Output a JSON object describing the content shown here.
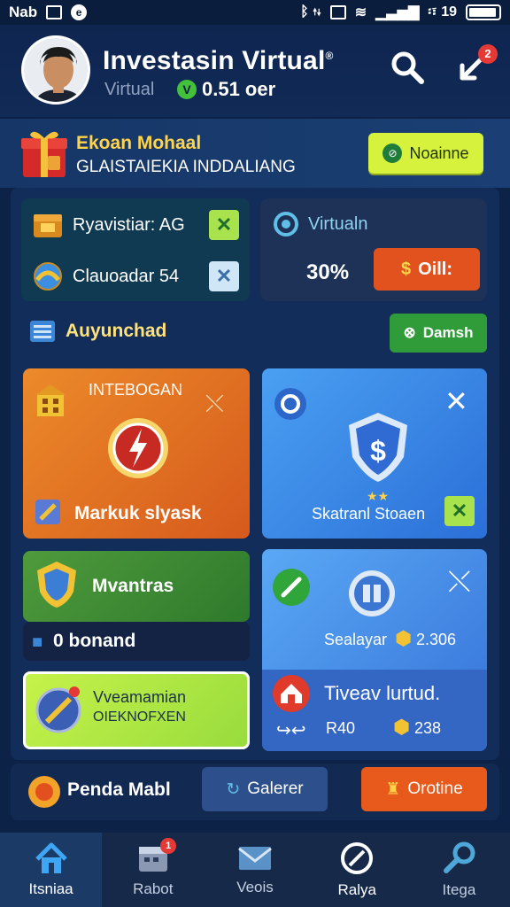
{
  "status_bar": {
    "carrier": "Nab",
    "right_text": "ᛒ ⇅",
    "time_text": "፡፣ 19"
  },
  "header": {
    "title": "Investasin Virtual",
    "subtitle_label": "Virtual",
    "subtitle_value": "0.51 oer",
    "notification_count": "2",
    "icons": [
      "search-icon",
      "share-icon"
    ]
  },
  "banner": {
    "title": "Ekoan Mohaal",
    "subtitle": "GLAISTAIEKIA INDDALIANG",
    "button_label": "Noainne"
  },
  "stats": {
    "row1_label": "Ryavistiar: AG",
    "row2_label": "Clauoadar 54"
  },
  "virtual_card": {
    "title": "Virtualn",
    "percent": "30%",
    "button_label": "Oill:"
  },
  "section": {
    "title": "Auyunchad",
    "button_label": "Damsh"
  },
  "tiles": {
    "orange": {
      "caption": "INTEBOGAN",
      "label": "Markuk slyask"
    },
    "blue": {
      "label": "Skatranl Stoaen"
    },
    "green": {
      "label": "Mvantras"
    },
    "dark": {
      "label": "0 bonand"
    },
    "lime": {
      "title": "Vveamamian",
      "subtitle": "OIEKNOFXEN"
    },
    "blue2": {
      "label": "Sealayar",
      "value": "2.306",
      "title2": "Tiveav lurtud.",
      "sub_left": "R40",
      "sub_value": "238"
    }
  },
  "actions": {
    "left_label": "Penda Mabl",
    "blue_button": "Galerer",
    "orange_button": "Orotine"
  },
  "nav": {
    "items": [
      {
        "label": "Itsniaa",
        "icon": "home-icon"
      },
      {
        "label": "Rabot",
        "icon": "calendar-icon",
        "badge": "1"
      },
      {
        "label": "Veois",
        "icon": "mail-icon"
      },
      {
        "label": "Ralya",
        "icon": "compass-icon"
      },
      {
        "label": "Itega",
        "icon": "wrench-icon"
      }
    ]
  },
  "colors": {
    "background": "#0d2247",
    "accent_orange": "#e2521e",
    "accent_green": "#2f9b39",
    "accent_lime": "#d7f23c",
    "accent_blue": "#3572d8"
  }
}
